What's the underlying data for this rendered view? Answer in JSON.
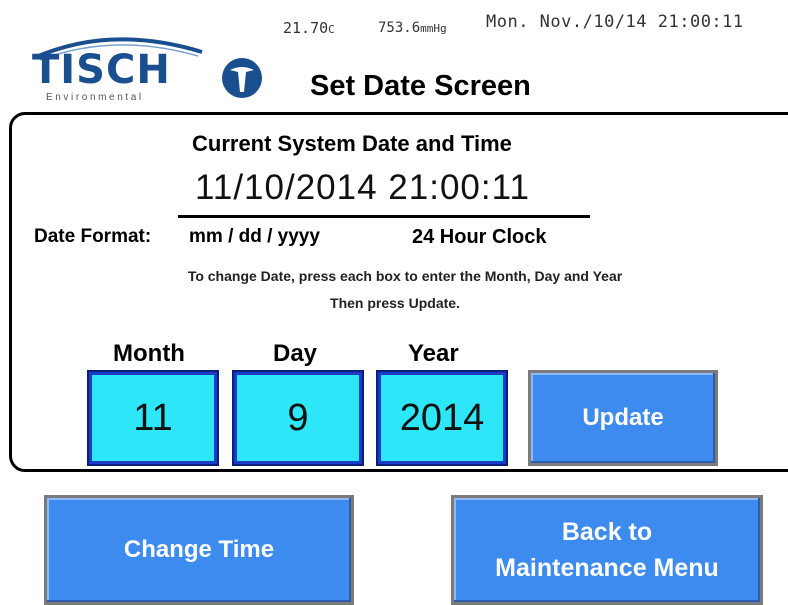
{
  "status_bar": {
    "temperature_value": "21.70",
    "temperature_unit": "C",
    "pressure_value": "753.6",
    "pressure_unit": "mmHg",
    "datetime": "Mon. Nov./10/14 21:00:11"
  },
  "logo": {
    "brand": "TISCH",
    "subtitle": "Environmental"
  },
  "header": {
    "title": "Set Date Screen"
  },
  "current": {
    "title": "Current System Date and Time",
    "value": "11/10/2014  21:00:11"
  },
  "format": {
    "label": "Date Format:",
    "value": "mm / dd / yyyy",
    "clock_mode": "24 Hour Clock"
  },
  "instructions": {
    "line1": "To change Date, press each box to enter the Month, Day and Year",
    "line2": "Then press Update."
  },
  "fields": {
    "month": {
      "label": "Month",
      "value": "11"
    },
    "day": {
      "label": "Day",
      "value": "9"
    },
    "year": {
      "label": "Year",
      "value": "2014"
    }
  },
  "buttons": {
    "update": "Update",
    "change_time": "Change Time",
    "back_line1": "Back to",
    "back_line2": "Maintenance Menu"
  },
  "colors": {
    "input_fill": "#2de6f7",
    "button_fill": "#3e8bf0",
    "logo_blue": "#1a4f8f"
  }
}
